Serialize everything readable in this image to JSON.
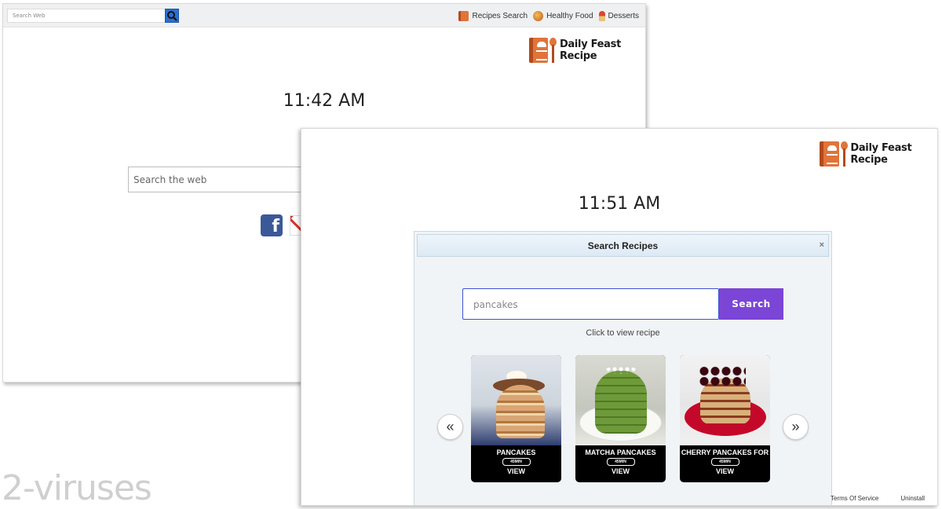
{
  "back_window": {
    "top_search_placeholder": "Search Web",
    "nav": [
      {
        "label": "Recipes Search",
        "icon": "recipe-book-icon"
      },
      {
        "label": "Healthy Food",
        "icon": "healthy-food-icon"
      },
      {
        "label": "Desserts",
        "icon": "dessert-icon"
      }
    ],
    "logo_text": "Daily Feast Recipe",
    "clock": "11:42 AM",
    "web_search_placeholder": "Search the web",
    "social": [
      "facebook-icon",
      "gmail-icon"
    ]
  },
  "front_window": {
    "logo_text": "Daily Feast Recipe",
    "clock": "11:51 AM",
    "footer": {
      "terms": "Terms Of Service",
      "uninstall": "Uninstall"
    }
  },
  "modal": {
    "title": "Search Recipes",
    "close": "×",
    "input_value": "pancakes",
    "search_button": "Search",
    "hint": "Click to view recipe",
    "prev": "«",
    "next": "»",
    "cards": [
      {
        "title": "PANCAKES",
        "time": "45MIN",
        "view": "VIEW"
      },
      {
        "title": "MATCHA PANCAKES",
        "time": "45MIN",
        "view": "VIEW"
      },
      {
        "title": "CHERRY PANCAKES FOR",
        "time": "45MIN",
        "view": "VIEW"
      }
    ]
  },
  "watermark": "2-viruses",
  "colors": {
    "accent_purple": "#7b45d6",
    "input_border": "#3f51d8",
    "logo_orange": "#e0743a",
    "facebook": "#3b5998"
  }
}
